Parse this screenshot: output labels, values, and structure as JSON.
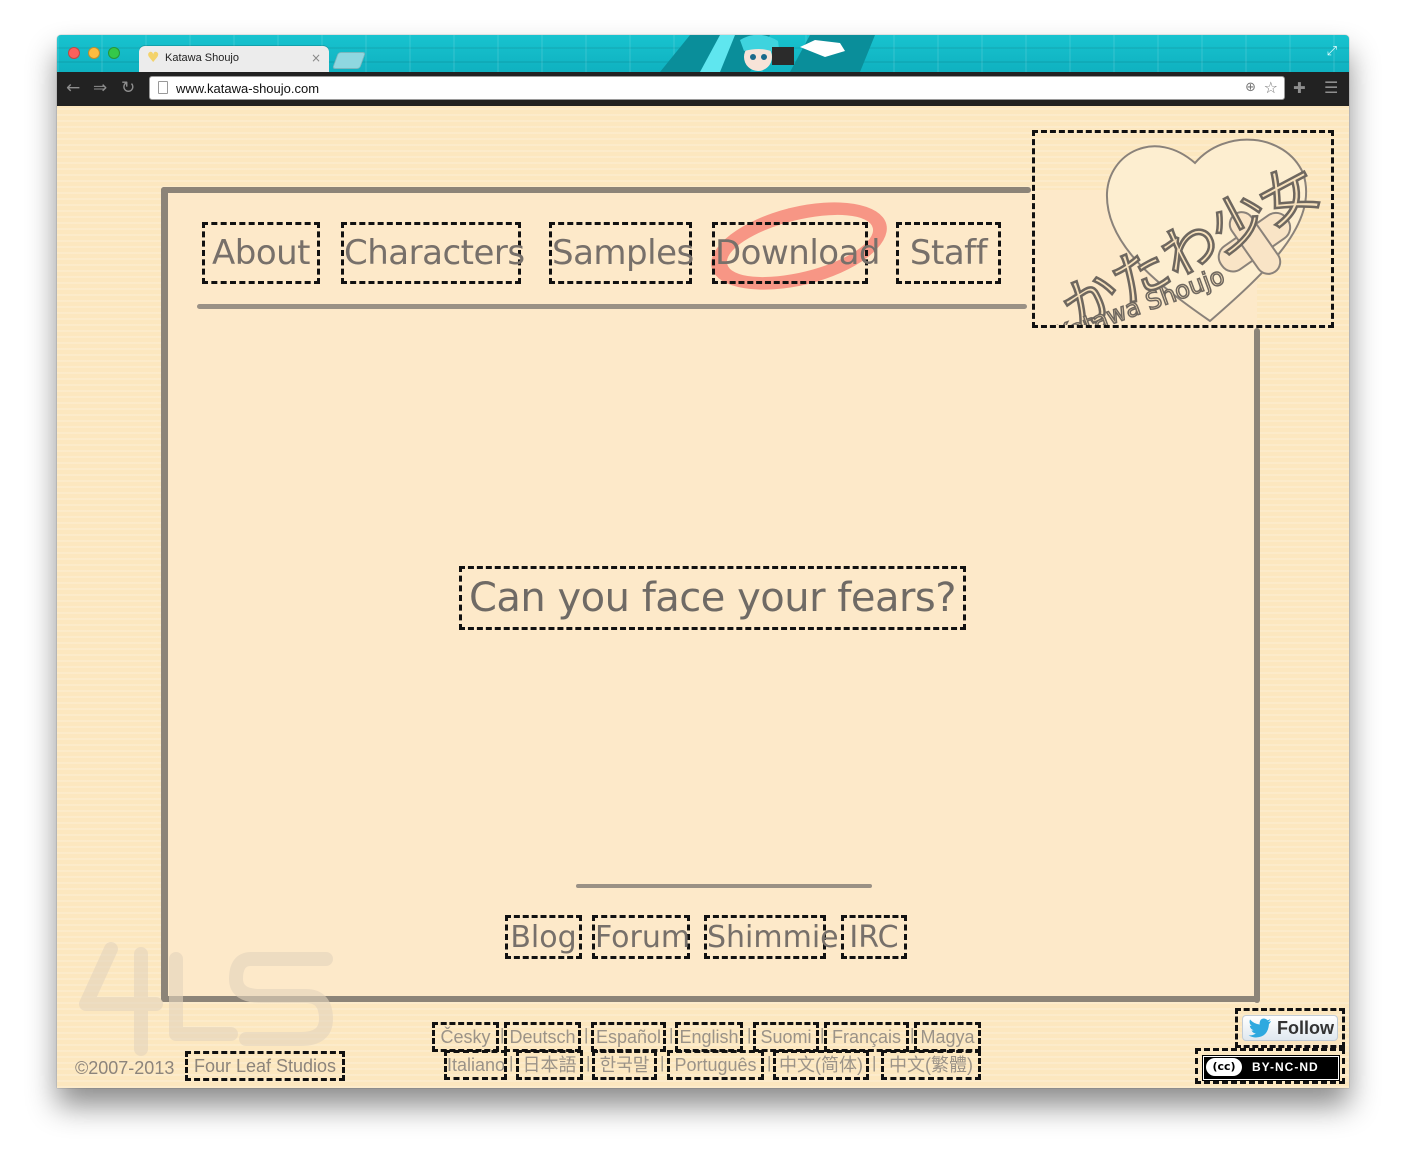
{
  "browser": {
    "tab_title": "Katawa Shoujo",
    "tab_close": "×",
    "url": "www.katawa-shoujo.com"
  },
  "nav": {
    "items": [
      "About",
      "Characters",
      "Samples",
      "Download",
      "Staff"
    ]
  },
  "logo": {
    "japanese": "かたわ少女",
    "romaji": "Katawa Shoujo"
  },
  "tagline": "Can you face your fears?",
  "community_links": [
    "Blog",
    "Forum",
    "Shimmie",
    "IRC"
  ],
  "footer": {
    "copyright": "©2007-2013",
    "company": "Four Leaf Studios",
    "languages_row1": [
      "Česky",
      "Deutsch",
      "Español",
      "English",
      "Suomi",
      "Français",
      "Magya"
    ],
    "languages_row2": [
      "Italiano",
      "日本語",
      "한국말",
      "Português",
      "中文(简体)",
      "中文(繁體)"
    ],
    "separator": "|"
  },
  "social": {
    "follow_label": "Follow",
    "license_label": "BY-NC-ND",
    "cc_label": "(cc)"
  },
  "colors": {
    "page_bg": "#fce7bf",
    "frame_bg": "#fde9c9",
    "text": "#77706a",
    "accent_swoosh": "#f4796e",
    "titlebar": "#18c3cf"
  }
}
